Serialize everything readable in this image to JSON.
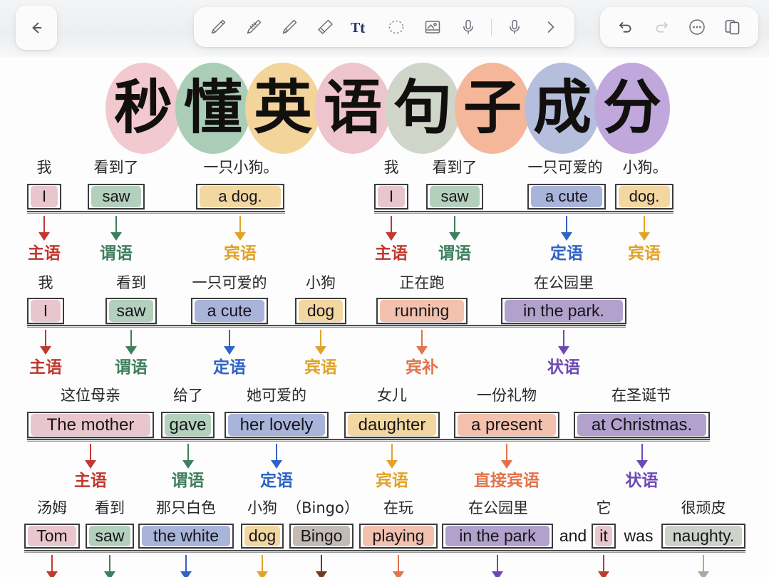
{
  "app": {
    "back_label": "←"
  },
  "toolbar": {
    "tools": [
      {
        "name": "pen-icon",
        "label": "Pen"
      },
      {
        "name": "pencil-icon",
        "label": "Pencil"
      },
      {
        "name": "highlighter-icon",
        "label": "Highlighter"
      },
      {
        "name": "eraser-icon",
        "label": "Eraser"
      },
      {
        "name": "text-tool-icon",
        "label": "Tt"
      },
      {
        "name": "lasso-select-icon",
        "label": "Lasso"
      },
      {
        "name": "image-icon",
        "label": "Image"
      },
      {
        "name": "microphone-icon",
        "label": "Microphone"
      },
      {
        "name": "microphone-record-icon",
        "label": "Record"
      },
      {
        "name": "chevron-right-icon",
        "label": "More tools"
      }
    ],
    "active_tool": "text-tool-icon",
    "active_tool_color": "#27356b",
    "actions": [
      {
        "name": "undo-icon",
        "label": "Undo",
        "enabled": true
      },
      {
        "name": "redo-icon",
        "label": "Redo",
        "enabled": false
      },
      {
        "name": "more-options-icon",
        "label": "More"
      },
      {
        "name": "pages-icon",
        "label": "Pages"
      }
    ]
  },
  "title": {
    "text": "秒懂英语句子成分",
    "chars": [
      "秒",
      "懂",
      "英",
      "语",
      "句",
      "子",
      "成",
      "分"
    ],
    "blob_colors": [
      "#f2c9cf",
      "#a9cdb6",
      "#f3d49a",
      "#eec5cd",
      "#cfd6c9",
      "#f4b79a",
      "#b6bedd",
      "#c0a8dd"
    ]
  },
  "palette": {
    "subject": "#e9c6ce",
    "predicate": "#b3d0bd",
    "attributive": "#a9b4da",
    "object": "#f2d7a0",
    "complement": "#f3c1ad",
    "adverbial": "#b1a1cc",
    "appositive": "#c4bbb4",
    "predicative": "#cdd3ca"
  },
  "tag_colors": {
    "subject": "#c0392f",
    "predicate": "#3d7f5e",
    "attributive": "#2f63c4",
    "object": "#e0a32a",
    "complement": "#e2734a",
    "adverbial": "#6e48b6",
    "direct_object": "#e2734a",
    "appositive": "#6b3b22",
    "predicative": "#9fb09b"
  },
  "rows": [
    {
      "id": "row-1",
      "examples": [
        {
          "id": "ex-1a",
          "items": [
            {
              "cn": "我",
              "en": "I",
              "color": "subject",
              "tag": "主语",
              "tag_color": "subject"
            },
            {
              "cn": "看到了",
              "en": "saw",
              "color": "predicate",
              "tag": "谓语",
              "tag_color": "predicate"
            },
            {
              "cn": "一只小狗。",
              "en": "a dog.",
              "color": "object",
              "tag": "宾语",
              "tag_color": "object"
            }
          ]
        },
        {
          "id": "ex-1b",
          "items": [
            {
              "cn": "我",
              "en": "I",
              "color": "subject",
              "tag": "主语",
              "tag_color": "subject"
            },
            {
              "cn": "看到了",
              "en": "saw",
              "color": "predicate",
              "tag": "谓语",
              "tag_color": "predicate"
            },
            {
              "cn": "一只可爱的",
              "en": "a  cute",
              "color": "attributive",
              "tag": "定语",
              "tag_color": "attributive"
            },
            {
              "cn": "小狗。",
              "en": "dog.",
              "color": "object",
              "tag": "宾语",
              "tag_color": "object"
            }
          ]
        }
      ]
    },
    {
      "id": "row-2",
      "examples": [
        {
          "id": "ex-2",
          "items": [
            {
              "cn": "我",
              "en": "I",
              "color": "subject",
              "tag": "主语",
              "tag_color": "subject"
            },
            {
              "cn": "看到",
              "en": "saw",
              "color": "predicate",
              "tag": "谓语",
              "tag_color": "predicate"
            },
            {
              "cn": "一只可爱的",
              "en": "a cute",
              "color": "attributive",
              "tag": "定语",
              "tag_color": "attributive"
            },
            {
              "cn": "小狗",
              "en": "dog",
              "color": "object",
              "tag": "宾语",
              "tag_color": "object"
            },
            {
              "cn": "正在跑",
              "en": "running",
              "color": "complement",
              "tag": "宾补",
              "tag_color": "complement"
            },
            {
              "cn": "在公园里",
              "en": "in the park.",
              "color": "adverbial",
              "tag": "状语",
              "tag_color": "adverbial"
            }
          ]
        }
      ]
    },
    {
      "id": "row-3",
      "examples": [
        {
          "id": "ex-3",
          "items": [
            {
              "cn": "这位母亲",
              "en": "The mother",
              "color": "subject",
              "tag": "主语",
              "tag_color": "subject"
            },
            {
              "cn": "给了",
              "en": "gave",
              "color": "predicate",
              "tag": "谓语",
              "tag_color": "predicate"
            },
            {
              "cn": "她可爱的",
              "en": "her lovely",
              "color": "attributive",
              "tag": "定语",
              "tag_color": "attributive"
            },
            {
              "cn": "女儿",
              "en": "daughter",
              "color": "object",
              "tag": "宾语",
              "tag_color": "object"
            },
            {
              "cn": "一份礼物",
              "en": "a present",
              "color": "complement",
              "tag": "直接宾语",
              "tag_color": "direct_object"
            },
            {
              "cn": "在圣诞节",
              "en": "at Christmas.",
              "color": "adverbial",
              "tag": "状语",
              "tag_color": "adverbial"
            }
          ]
        }
      ]
    },
    {
      "id": "row-4",
      "examples": [
        {
          "id": "ex-4",
          "items": [
            {
              "cn": "汤姆",
              "en": "Tom",
              "color": "subject",
              "tag": "",
              "tag_color": "subject"
            },
            {
              "cn": "看到",
              "en": "saw",
              "color": "predicate",
              "tag": "",
              "tag_color": "predicate"
            },
            {
              "cn": "那只白色",
              "en": "the white",
              "color": "attributive",
              "tag": "",
              "tag_color": "attributive"
            },
            {
              "cn": "小狗",
              "en": "dog",
              "color": "object",
              "tag": "",
              "tag_color": "object"
            },
            {
              "cn": "（Bingo）",
              "en": "Bingo",
              "color": "appositive",
              "tag": "",
              "tag_color": "appositive"
            },
            {
              "cn": "在玩",
              "en": "playing",
              "color": "complement",
              "tag": "",
              "tag_color": "complement"
            },
            {
              "cn": "在公园里",
              "en": "in the park",
              "color": "adverbial",
              "tag": "",
              "tag_color": "adverbial"
            },
            {
              "cn": "",
              "en": "and",
              "color": "none",
              "tag": "",
              "tag_color": "subject"
            },
            {
              "cn": "它",
              "en": "it",
              "color": "subject",
              "tag": "",
              "tag_color": "subject"
            },
            {
              "cn": "",
              "en": "was",
              "color": "none",
              "tag": "",
              "tag_color": "subject"
            },
            {
              "cn": "很顽皮",
              "en": "naughty.",
              "color": "predicative",
              "tag": "",
              "tag_color": "predicative"
            }
          ]
        }
      ]
    }
  ]
}
